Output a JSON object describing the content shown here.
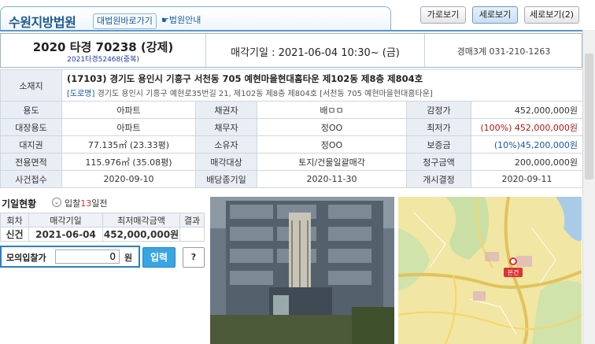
{
  "header": {
    "court_name": "수원지방법원",
    "supreme_link": "대법원바로가기",
    "court_info": "법원안내",
    "view_buttons": [
      "가로보기",
      "세로보기",
      "세로보기(2)"
    ]
  },
  "case": {
    "number": "2020 타경 70238 (강제)",
    "sub": "2021타경52468(중복)",
    "sale_date": "매각기일 : 2021-06-04 10:30~ (금)",
    "dept": "경매3계 031-210-1263"
  },
  "info": {
    "address_label": "소재지",
    "address_main": "(17103) 경기도 용인시 기흥구 서천동 705 예현마을현대홈타운 제102동 제8층 제804호",
    "road_tag": "[도로명]",
    "road_address": "경기도 용인시 기흥구 예현로35번길 21, 제102동 제8층 제804호 [서천동 705 예현마을현대홈타운]",
    "rows": [
      [
        "용도",
        "아파트",
        "채권자",
        "배ㅁㅁ",
        "감정가",
        "452,000,000원"
      ],
      [
        "대장용도",
        "아파트",
        "채무자",
        "정OO",
        "최저가",
        "(100%) 452,000,000원"
      ],
      [
        "대지권",
        "77.135㎡ (23.33평)",
        "소유자",
        "정OO",
        "보증금",
        "(10%)45,200,000원"
      ],
      [
        "전용면적",
        "115.976㎡ (35.08평)",
        "매각대상",
        "토지/건물일괄매각",
        "청구금액",
        "200,000,000원"
      ],
      [
        "사건접수",
        "2020-09-10",
        "배당종기일",
        "2020-11-30",
        "개시결정",
        "2020-09-11"
      ]
    ]
  },
  "history": {
    "title": "기일현황",
    "note_prefix": "입찰",
    "note_days": "13",
    "note_suffix": "일전",
    "headers": [
      "회차",
      "매각기일",
      "최저매각금액",
      "결과"
    ],
    "row": [
      "신건",
      "2021-06-04",
      "452,000,000원",
      ""
    ]
  },
  "mock_bid": {
    "label": "모의입찰가",
    "value": "0",
    "unit": "원",
    "submit": "입력",
    "help": "?"
  },
  "map": {
    "pin_label": "본건"
  }
}
